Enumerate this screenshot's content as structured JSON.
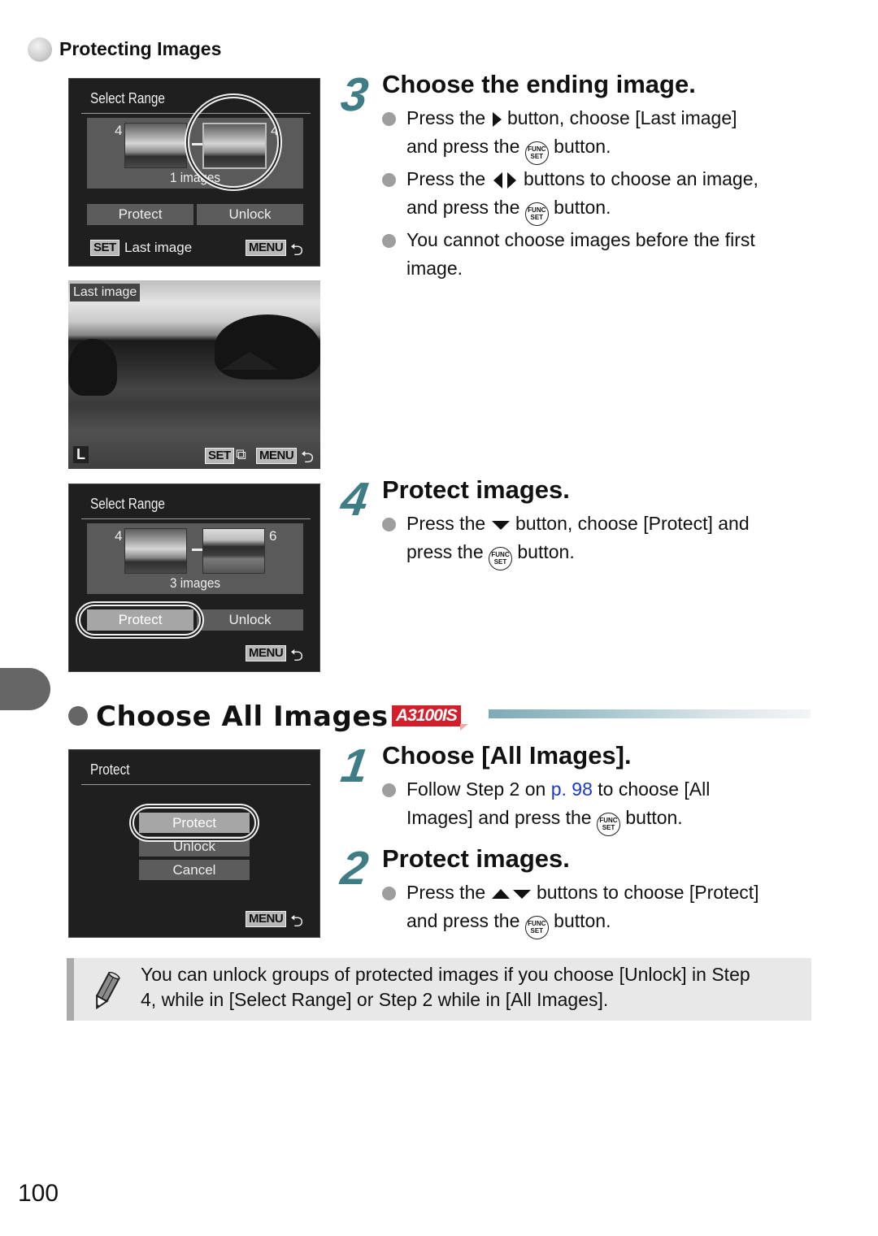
{
  "header": {
    "section_title": "Protecting Images"
  },
  "screen1": {
    "title": "Select Range",
    "start_num": "4",
    "end_num": "4",
    "count": "1 images",
    "buttons": [
      "Protect",
      "Unlock"
    ],
    "set_key": "SET",
    "set_label": "Last image",
    "menu_key": "MENU"
  },
  "screen2": {
    "overlay_label": "Last image",
    "size_label": "L",
    "set_key": "SET",
    "menu_key": "MENU"
  },
  "screen3": {
    "title": "Select Range",
    "start_num": "4",
    "end_num": "6",
    "count": "3 images",
    "buttons": [
      "Protect",
      "Unlock"
    ],
    "active_button": "Protect",
    "menu_key": "MENU"
  },
  "step3": {
    "number": "3",
    "title": "Choose the ending image.",
    "bullets": [
      {
        "pre": "Press the",
        "post": "button, choose [Last image]",
        "line2_pre": "and press the",
        "line2_post": "button."
      },
      {
        "pre": "Press the",
        "post": "buttons to choose an image,",
        "line2_pre": "and press the",
        "line2_post": "button."
      },
      {
        "line1": "You cannot choose images before the first",
        "line2": "image."
      }
    ]
  },
  "step4": {
    "number": "4",
    "title": "Protect images.",
    "bullet": {
      "pre": "Press the",
      "post": "button, choose [Protect] and",
      "line2_pre": "press the",
      "line2_post": "button."
    }
  },
  "section2": {
    "title": "Choose All Images",
    "badge": "A3100IS",
    "badge_color": "#d21f2c"
  },
  "screen4": {
    "title": "Protect",
    "options": [
      "Protect",
      "Unlock",
      "Cancel"
    ],
    "active_option": "Protect",
    "menu_key": "MENU"
  },
  "step1": {
    "number": "1",
    "title": "Choose [All Images].",
    "bullet": {
      "pre": "Follow Step 2 on",
      "link": "p. 98",
      "post": "to choose [All",
      "line2_pre": "Images] and press the",
      "line2_post": "button."
    }
  },
  "step2": {
    "number": "2",
    "title": "Protect images.",
    "bullet": {
      "pre": "Press the",
      "post": "buttons to choose [Protect]",
      "line2_pre": "and press the",
      "line2_post": "button."
    }
  },
  "func_icon": {
    "top": "FUNC",
    "bottom": "SET"
  },
  "note": {
    "line1": "You can unlock groups of protected images if you choose [Unlock] in Step",
    "line2": "4, while in [Select Range] or Step 2 while in [All Images]."
  },
  "footer": {
    "page_number": "100"
  },
  "colors": {
    "step_number": "#3e7c86",
    "link": "#1a36d8",
    "bullet": "#9e9e9e"
  }
}
